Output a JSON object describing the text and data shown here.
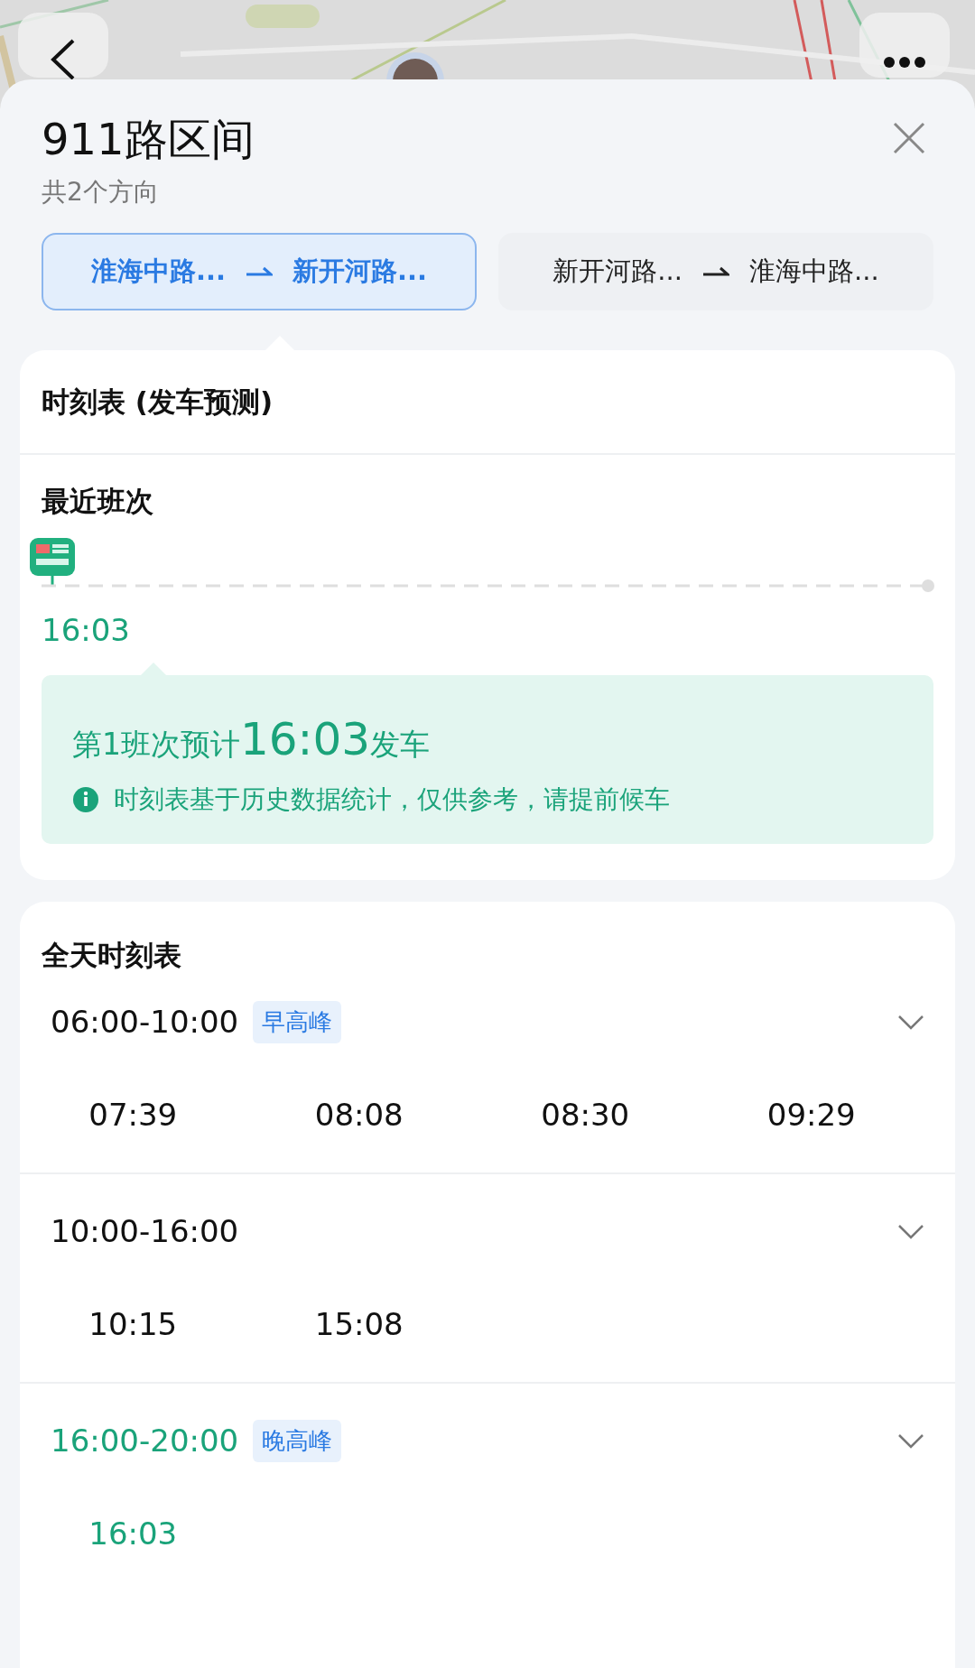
{
  "header": {
    "title": "911路区间",
    "subtitle": "共2个方向"
  },
  "directions": [
    {
      "from": "淮海中路...",
      "to": "新开河路...",
      "selected": true
    },
    {
      "from": "新开河路...",
      "to": "淮海中路...",
      "selected": false
    }
  ],
  "forecast": {
    "title": "时刻表 (发车预测)",
    "section": "最近班次",
    "next_time": "16:03",
    "headline": "第1班次预计**16:03**发车",
    "note": "时刻表基于历史数据统计，仅供参考，请提前候车"
  },
  "full_day": {
    "title": "全天时刻表",
    "periods": [
      {
        "range": "06:00-10:00",
        "tag": "早高峰",
        "current": false,
        "times": [
          "07:39",
          "08:08",
          "08:30",
          "09:29"
        ]
      },
      {
        "range": "10:00-16:00",
        "current": false,
        "times": [
          "10:15",
          "15:08"
        ]
      },
      {
        "range": "16:00-20:00",
        "tag": "晚高峰",
        "current": true,
        "times": [
          "16:03"
        ]
      }
    ]
  }
}
